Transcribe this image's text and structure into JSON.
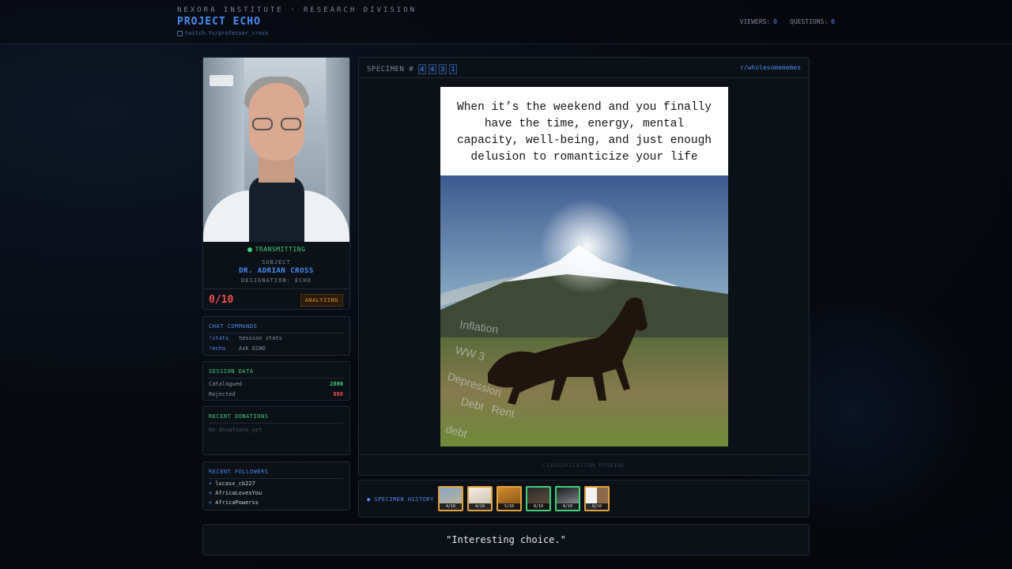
{
  "header": {
    "institute": "NEXORA INSTITUTE · RESEARCH DIVISION",
    "project": "PROJECT ECHO",
    "channel": "twitch.tv/professor_cross",
    "viewers_label": "VIEWERS:",
    "viewers": "0",
    "questions_label": "QUESTIONS:",
    "questions": "0"
  },
  "subject": {
    "status": "TRANSMITTING",
    "label": "SUBJECT",
    "name": "DR. ADRIAN CROSS",
    "designation": "DESIGNATION: ECHO",
    "score": "0/10",
    "state": "ANALYZING"
  },
  "commands": {
    "title": "CHAT COMMANDS",
    "items": [
      {
        "cmd": "!stats",
        "desc": "Session stats"
      },
      {
        "cmd": "!echo",
        "desc": "Ask ECHO"
      }
    ]
  },
  "session": {
    "title": "SESSION DATA",
    "catalogued_label": "Catalogued",
    "catalogued": "2880",
    "rejected_label": "Rejected",
    "rejected": "886"
  },
  "donations": {
    "title": "RECENT DONATIONS",
    "empty": "No donations yet"
  },
  "followers": {
    "title": "RECENT FOLLOWERS",
    "items": [
      "lucasx_cb227",
      "AfricaLovesYou",
      "AfricaPowerss"
    ]
  },
  "specimen": {
    "label": "SPECIMEN #",
    "digits": [
      "4",
      "4",
      "3",
      "1"
    ],
    "subreddit": "r/wholesomememes",
    "caption": "When it’s the weekend and you finally have the time, energy, mental capacity, well-being, and just enough delusion to romanticize your life",
    "overlay_words": [
      "Inflation",
      "WW 3",
      "Depression",
      "Debt",
      "Rent",
      "debt"
    ],
    "footer": "CLASSIFICATION PENDING"
  },
  "history": {
    "title": "● SPECIMEN HISTORY",
    "items": [
      {
        "score": "4/10",
        "tone": "amber"
      },
      {
        "score": "4/10",
        "tone": "amber"
      },
      {
        "score": "5/10",
        "tone": "amber"
      },
      {
        "score": "8/10",
        "tone": "green"
      },
      {
        "score": "8/10",
        "tone": "green"
      },
      {
        "score": "6/10",
        "tone": "amber"
      }
    ]
  },
  "quote": "\"Interesting choice.\""
}
